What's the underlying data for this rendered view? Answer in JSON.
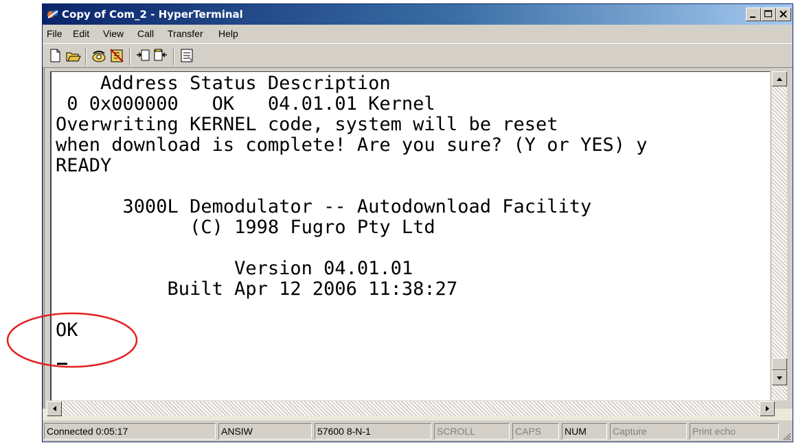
{
  "window": {
    "title": "Copy of Com_2 - HyperTerminal",
    "icons": [
      "hyperterminal-app-icon",
      "minimize-icon",
      "maximize-icon",
      "close-icon"
    ]
  },
  "menu": [
    {
      "label": "File"
    },
    {
      "label": "Edit"
    },
    {
      "label": "View"
    },
    {
      "label": "Call"
    },
    {
      "label": "Transfer"
    },
    {
      "label": "Help"
    }
  ],
  "toolbar": {
    "buttons": [
      "new-icon",
      "open-icon",
      "connect-icon",
      "disconnect-icon",
      "send-icon",
      "receive-icon",
      "properties-icon"
    ]
  },
  "terminal": {
    "lines": [
      "    Address Status Description",
      " 0 0x000000   OK   04.01.01 Kernel",
      "Overwriting KERNEL code, system will be reset",
      "when download is complete! Are you sure? (Y or YES) y",
      "READY",
      "",
      "      3000L Demodulator -- Autodownload Facility",
      "            (C) 1998 Fugro Pty Ltd",
      "",
      "                Version 04.01.01",
      "          Built Apr 12 2006 11:38:27",
      "OK"
    ]
  },
  "statusbar": {
    "connected": "Connected 0:05:17",
    "emulation": "ANSIW",
    "port_settings": "57600 8-N-1",
    "scroll": "SCROLL",
    "caps": "CAPS",
    "num": "NUM",
    "capture": "Capture",
    "print_echo": "Print echo"
  },
  "colors": {
    "annotation": "#e02020",
    "titlebar_start": "#0a246a",
    "titlebar_end": "#a6caf0"
  }
}
